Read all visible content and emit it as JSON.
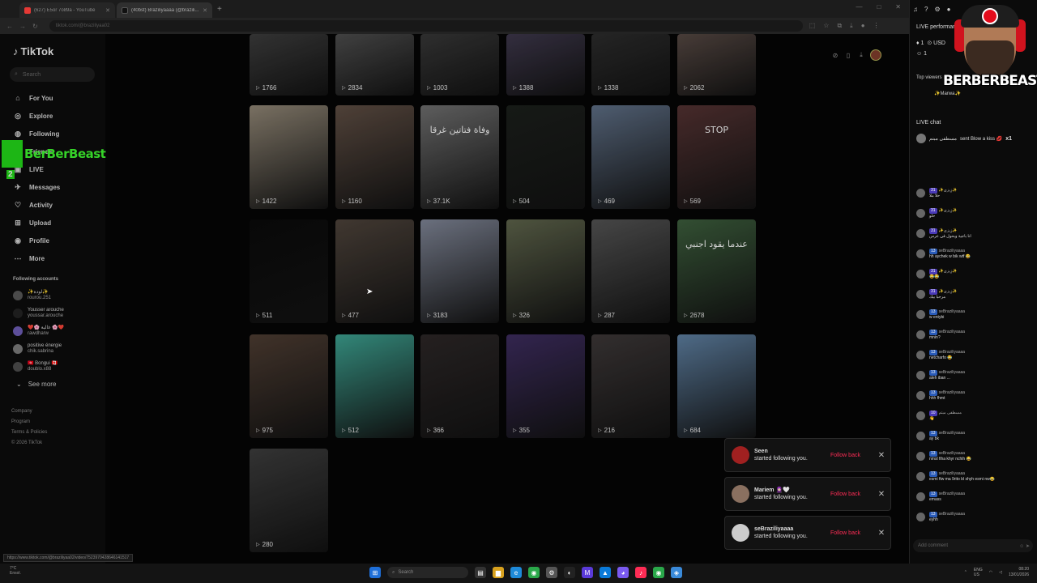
{
  "browser": {
    "tabs": [
      {
        "title": "(627) E5or 7o89a - YouTube",
        "color": "#e53935"
      },
      {
        "title": "(40bst) Braziliyaaaa (@brazili...",
        "color": "#222222"
      }
    ],
    "url": "tiktok.com/@braziliyaa02"
  },
  "sidebar": {
    "logo": "TikTok",
    "search_placeholder": "Search",
    "nav": [
      {
        "label": "For You",
        "icon": "home-icon"
      },
      {
        "label": "Explore",
        "icon": "compass-icon"
      },
      {
        "label": "Following",
        "icon": "following-icon"
      },
      {
        "label": "Friends",
        "icon": "friends-icon"
      },
      {
        "label": "LIVE",
        "icon": "live-icon"
      },
      {
        "label": "Messages",
        "icon": "messages-icon"
      },
      {
        "label": "Activity",
        "icon": "activity-icon"
      },
      {
        "label": "Upload",
        "icon": "upload-icon"
      },
      {
        "label": "Profile",
        "icon": "profile-icon"
      },
      {
        "label": "More",
        "icon": "more-icon"
      }
    ],
    "following_title": "Following accounts",
    "following": [
      {
        "name": "✨لودة✨",
        "handle": "rourou.251"
      },
      {
        "name": "Yousser arouche",
        "handle": "youssar.arouche"
      },
      {
        "name": "❤️🌸 غالية 🌸❤️",
        "handle": "rawdharw"
      },
      {
        "name": "positive énergie",
        "handle": "chik.sabrina"
      },
      {
        "name": "🇹🇳 Bongui 🇨🇦",
        "handle": "doublo.x88"
      }
    ],
    "see_more": "See more",
    "footer": [
      "Company",
      "Program",
      "Terms & Policies",
      "© 2026 TikTok"
    ]
  },
  "overlay": {
    "brand": "BerBerBeast",
    "counter": "2"
  },
  "videos": [
    {
      "views": "1766",
      "bg": "#3a3a3a"
    },
    {
      "views": "2834",
      "bg": "#4a4a4a"
    },
    {
      "views": "1003",
      "bg": "#353535"
    },
    {
      "views": "1388",
      "bg": "#3b3548"
    },
    {
      "views": "1338",
      "bg": "#2a2a2a"
    },
    {
      "views": "2062",
      "bg": "#524540"
    },
    {
      "views": "1422",
      "bg": "#8a8070"
    },
    {
      "views": "1160",
      "bg": "#5a4a40"
    },
    {
      "views": "37.1K",
      "bg": "#6a6a6a",
      "caption": "وفاة فتاتين غرقا"
    },
    {
      "views": "504",
      "bg": "#1a1e1a"
    },
    {
      "views": "469",
      "bg": "#5a6a80"
    },
    {
      "views": "569",
      "bg": "#503030",
      "caption": "STOP"
    },
    {
      "views": "511",
      "bg": "#0a0a0a"
    },
    {
      "views": "477",
      "bg": "#4a4038"
    },
    {
      "views": "3183",
      "bg": "#7a8090"
    },
    {
      "views": "326",
      "bg": "#5a6048"
    },
    {
      "views": "287",
      "bg": "#505050"
    },
    {
      "views": "2678",
      "bg": "#3a5a3a",
      "caption": "عندما يقود اجنبي"
    },
    {
      "views": "975",
      "bg": "#4a3a30"
    },
    {
      "views": "512",
      "bg": "#3a9a8a"
    },
    {
      "views": "366",
      "bg": "#2a2525"
    },
    {
      "views": "355",
      "bg": "#3a2a5a"
    },
    {
      "views": "216",
      "bg": "#3a3535"
    },
    {
      "views": "684",
      "bg": "#5a7a9a"
    },
    {
      "views": "280",
      "bg": "#3a3a3a"
    }
  ],
  "notifications": [
    {
      "name": "Seen",
      "text": "started following you.",
      "action": "Follow back",
      "color": "#a02020"
    },
    {
      "name": "Mariem 🧕🏻🤍",
      "text": "started following you.",
      "action": "Follow back",
      "color": "#8a7060"
    },
    {
      "name": "seBraziliyaaaa",
      "text": "started following you.",
      "action": "Follow back",
      "color": "#cccccc"
    }
  ],
  "status_url": "https://www.tiktok.com/@braziliyaa02/video/7523970428646141517",
  "live": {
    "title": "LIVE performance",
    "stats": [
      "1",
      "USD",
      "1"
    ],
    "top_viewers_label": "Top viewers",
    "viewer": "✨Marwa✨",
    "chat_title": "LIVE chat",
    "gift": {
      "user": "مسطفى مبتم",
      "text": "sent Blow a kiss 💋",
      "count": "x1"
    },
    "messages": [
      {
        "level": "31",
        "user": "✨زِيزي✨",
        "text": "حلا ملا"
      },
      {
        "level": "31",
        "user": "✨زِيزي✨",
        "text": "حلو"
      },
      {
        "level": "31",
        "user": "✨زِيزي✨",
        "text": "انا باجية وبحول في عرس"
      },
      {
        "level": "13",
        "user": "seBraziliyaaaa",
        "text": "hh aychek w bik wtf 😂"
      },
      {
        "level": "31",
        "user": "✨زِيزي✨",
        "text": "😂😂"
      },
      {
        "level": "31",
        "user": "✨زِيزي✨",
        "text": "مرحبا بيك"
      },
      {
        "level": "13",
        "user": "seBraziliyaaaa",
        "text": "w entybi"
      },
      {
        "level": "13",
        "user": "seBraziliyaaaa",
        "text": "mnin?"
      },
      {
        "level": "13",
        "user": "seBraziliyaaaa",
        "text": "netcharfo 😂"
      },
      {
        "level": "13",
        "user": "seBraziliyaaaa",
        "text": "aleh iban ..."
      },
      {
        "level": "13",
        "user": "seBraziliyaaaa",
        "text": "hhh fhmt"
      },
      {
        "level": "10",
        "user": "مسطفى مبتم",
        "text": "👋"
      },
      {
        "level": "13",
        "user": "seBraziliyaaaa",
        "text": "ay bk"
      },
      {
        "level": "13",
        "user": "seBraziliyaaaa",
        "text": "nmsl fiha khyr nchih 😂"
      },
      {
        "level": "13",
        "user": "seBraziliyaaaa",
        "text": "esmi ftw ma 9rito bl shyh esmi nw😂"
      },
      {
        "level": "13",
        "user": "seBraziliyaaaa",
        "text": "emass"
      },
      {
        "level": "13",
        "user": "seBraziliyaaaa",
        "text": "eyhh"
      }
    ],
    "comment_placeholder": "Add comment"
  },
  "streamer": {
    "name": "BERBERBEAST"
  },
  "taskbar": {
    "weather": [
      "7°C",
      "Ensol."
    ],
    "search": "Search",
    "lang": [
      "ENG",
      "US"
    ],
    "time": "08:20",
    "date": "13/01/2026"
  }
}
